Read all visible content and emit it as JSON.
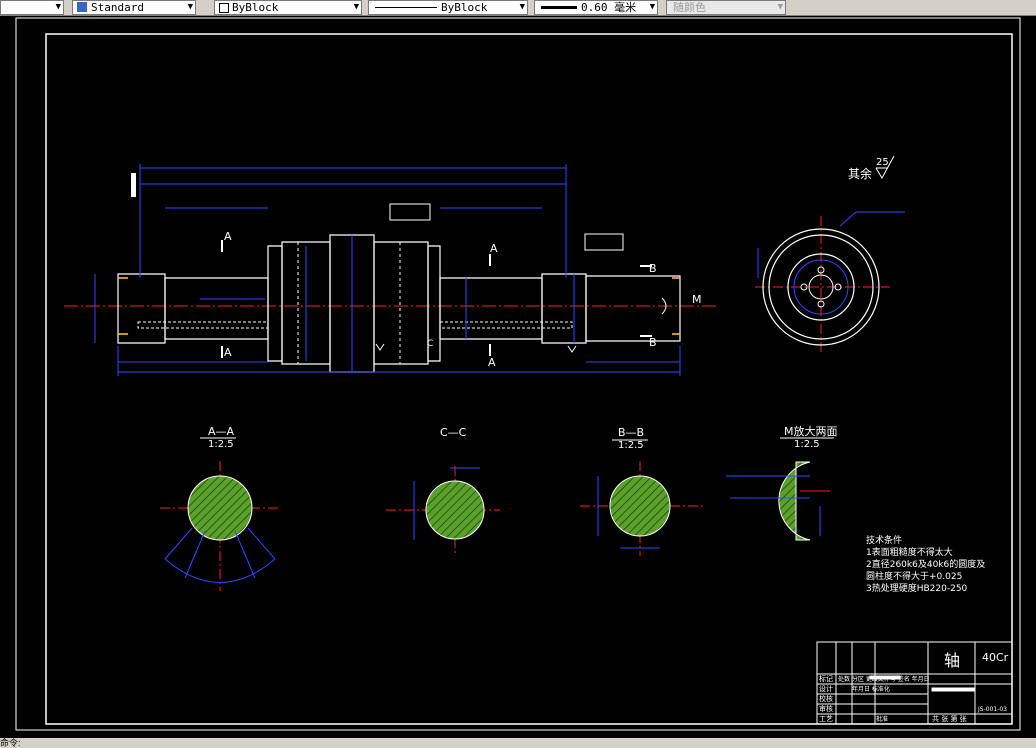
{
  "toolbar": {
    "textstyle": "Standard",
    "layer": "ByBlock",
    "linetype": "ByBlock",
    "lineweight": "0.60 毫米",
    "plotstyle": "随颜色"
  },
  "drawing": {
    "roughness_label": "其余",
    "roughness_value": "25",
    "section_label_a": "A",
    "section_label_b": "B",
    "section_label_c": "C",
    "section_label_m": "M",
    "sections": [
      {
        "title": "A—A",
        "scale": "1:2.5"
      },
      {
        "title": "C—C",
        "scale": ""
      },
      {
        "title": "B—B",
        "scale": "1:2.5"
      },
      {
        "title": "M放大两面",
        "scale": "1:2.5"
      }
    ],
    "tech_notes": {
      "heading": "技术条件",
      "lines": [
        "1表面粗糙度不得太大",
        "2直径260k6及40k6的圆度及",
        "圆柱度不得大于+0.025",
        "3热处理硬度HB220-250"
      ]
    },
    "titleblock": {
      "part_name": "轴",
      "code": "40Cr",
      "rows": [
        "标记",
        "设计",
        "校核",
        "审核",
        "工艺"
      ],
      "row_extras": [
        "处数  分区  更改文件号  签名  年月日",
        "年月日  标准化",
        "",
        "",
        "批准"
      ],
      "bottom": "共 张  第 张",
      "drawing_no": "JS-001-03"
    }
  },
  "status": {
    "prompt": "命令:"
  },
  "colors": {
    "outline": "#ffffff",
    "dimension": "#2a4bff",
    "centerline": "#ff2020",
    "hatch_fill": "#5aa02a",
    "accent": "#ffd400",
    "toolbar_bg": "#d4d0c8"
  }
}
